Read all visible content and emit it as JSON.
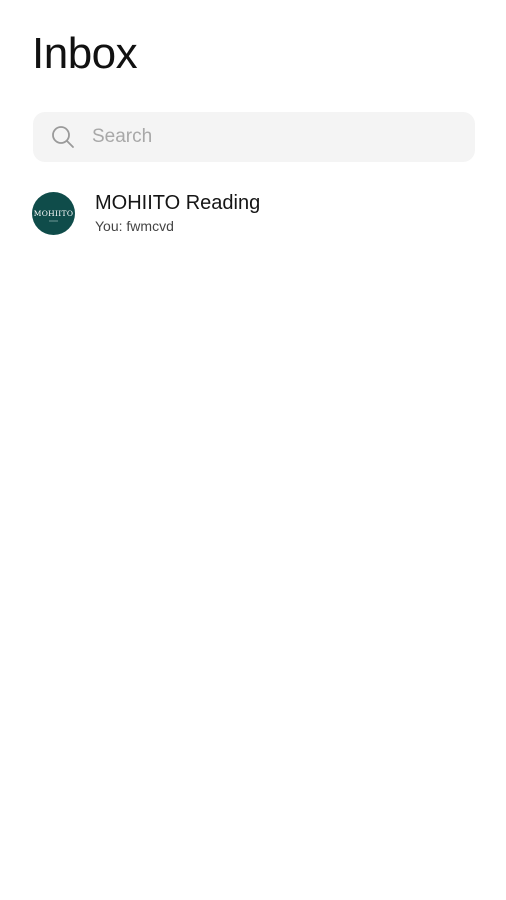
{
  "header": {
    "title": "Inbox"
  },
  "search": {
    "placeholder": "Search",
    "value": "",
    "icon": "search-icon"
  },
  "conversations": [
    {
      "name": "MOHIITO Reading",
      "preview": "You: fwmcvd",
      "avatar": {
        "logo_text": "MOHIITO",
        "background": "#0f4c4a"
      }
    }
  ],
  "colors": {
    "background": "#ffffff",
    "search_background": "#f4f4f4",
    "placeholder": "#a8a8a8",
    "text_primary": "#151515",
    "text_secondary": "#444444"
  }
}
